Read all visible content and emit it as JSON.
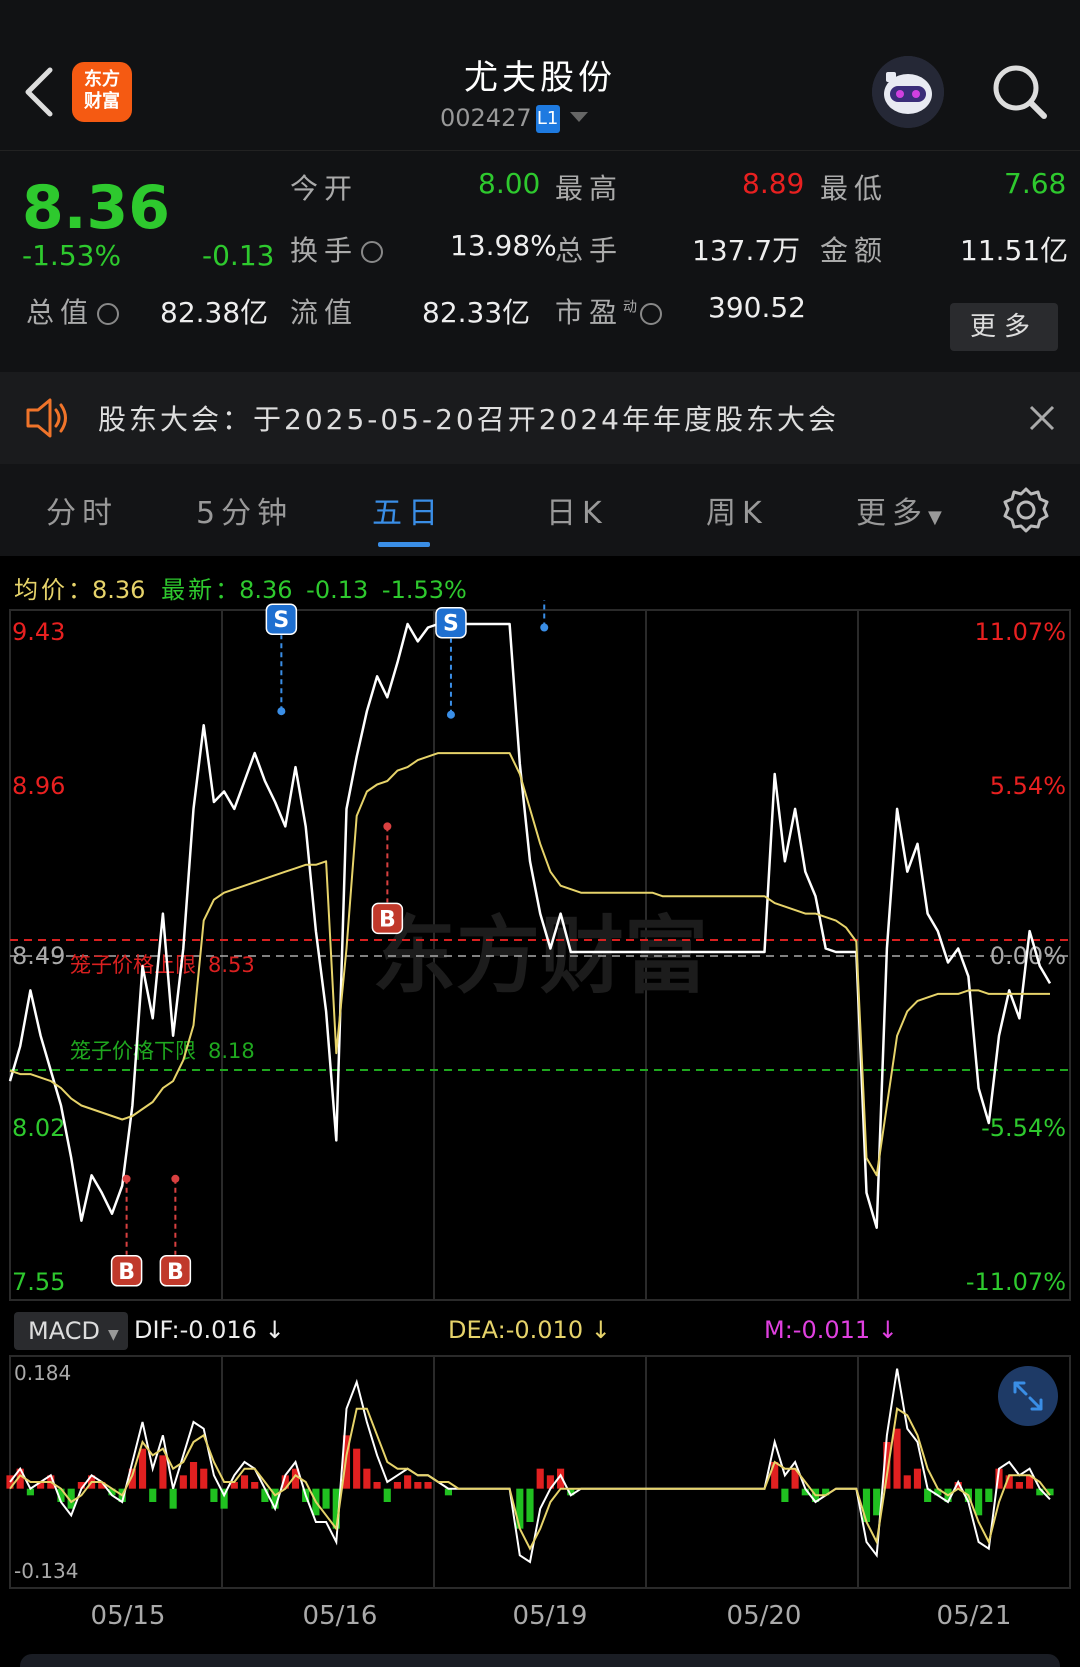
{
  "header": {
    "logo_line1": "东方",
    "logo_line2": "财富",
    "stock_name": "尤夫股份",
    "stock_code": "002427",
    "market_badge": "L1",
    "icons": [
      "back-arrow-icon",
      "robot-avatar-icon",
      "search-icon",
      "dropdown-triangle-icon"
    ]
  },
  "quote": {
    "price": "8.36",
    "change_pct": "-1.53%",
    "change": "-0.13",
    "open_label": "今开",
    "open": "8.00",
    "high_label": "最高",
    "high": "8.89",
    "low_label": "最低",
    "low": "7.68",
    "turnover_label": "换手",
    "turnover": "13.98%",
    "volume_label": "总手",
    "volume": "137.7万",
    "amount_label": "金额",
    "amount": "11.51亿",
    "mktcap_label": "总值",
    "mktcap": "82.38亿",
    "float_label": "流值",
    "float_cap": "82.33亿",
    "pe_label": "市盈",
    "pe_sup": "动",
    "pe": "390.52",
    "more_button": "更多",
    "colors": {
      "down": "#2ec92e",
      "up": "#e82020"
    }
  },
  "notice": {
    "text": "股东大会：于2025-05-20召开2024年年度股东大会",
    "icons": [
      "speaker-icon",
      "close-icon"
    ]
  },
  "tabs": {
    "items": [
      "分时",
      "5分钟",
      "五日",
      "日K",
      "周K",
      "更多"
    ],
    "active": "五日",
    "icons": [
      "settings-gear-icon"
    ]
  },
  "chart_data": {
    "type": "line",
    "legend": {
      "avg_label": "均价",
      "avg_value": "8.36",
      "latest_label": "最新",
      "latest_value": "8.36",
      "latest_change": "-0.13",
      "latest_pct": "-1.53%"
    },
    "left_ticks": [
      "9.43",
      "8.96",
      "8.49",
      "8.02",
      "7.55"
    ],
    "right_ticks": [
      "11.07%",
      "5.54%",
      "0.00%",
      "-5.54%",
      "-11.07%"
    ],
    "ylim": [
      7.55,
      9.43
    ],
    "prev_close": 8.49,
    "upper_band_label": "笼子价格上限",
    "upper_band_value": "8.53",
    "lower_band_label": "笼子价格下限",
    "lower_band_value": "8.18",
    "x_labels": [
      "05/15",
      "05/16",
      "05/19",
      "05/20",
      "05/21"
    ],
    "watermark": "东方财富",
    "markers": [
      {
        "label": "B",
        "day": 0,
        "pos": 0.55,
        "price": 7.84
      },
      {
        "label": "B",
        "day": 0,
        "pos": 0.78,
        "price": 7.84
      },
      {
        "label": "S",
        "day": 1,
        "pos": 0.28,
        "price": 9.18
      },
      {
        "label": "B",
        "day": 1,
        "pos": 0.78,
        "price": 8.85
      },
      {
        "label": "S",
        "day": 2,
        "pos": 0.08,
        "price": 9.17
      },
      {
        "label": "S",
        "day": 2,
        "pos": 0.52,
        "price": 9.42
      }
    ],
    "series": [
      {
        "name": "价格",
        "color": "#ffffff",
        "values": [
          8.12,
          8.22,
          8.38,
          8.25,
          8.15,
          8.05,
          7.9,
          7.72,
          7.85,
          7.8,
          7.74,
          7.82,
          8.05,
          8.45,
          8.3,
          8.6,
          8.25,
          8.5,
          8.9,
          9.14,
          8.92,
          8.95,
          8.9,
          8.98,
          9.06,
          8.98,
          8.92,
          8.85,
          9.02,
          8.85,
          8.55,
          8.32,
          7.95,
          8.9,
          9.05,
          9.18,
          9.28,
          9.22,
          9.32,
          9.43,
          9.38,
          9.42,
          9.43,
          9.4,
          9.43,
          9.43,
          9.43,
          9.43,
          9.43,
          9.43,
          9.03,
          8.75,
          8.6,
          8.5,
          8.6,
          8.49,
          8.49,
          8.49,
          8.49,
          8.49,
          8.49,
          8.49,
          8.49,
          8.49,
          8.49,
          8.49,
          8.49,
          8.49,
          8.49,
          8.49,
          8.49,
          8.49,
          8.49,
          8.49,
          8.49,
          9.0,
          8.75,
          8.9,
          8.72,
          8.65,
          8.5,
          8.49,
          8.49,
          8.49,
          7.8,
          7.7,
          8.5,
          8.9,
          8.72,
          8.8,
          8.6,
          8.55,
          8.46,
          8.5,
          8.42,
          8.1,
          8.0,
          8.25,
          8.38,
          8.3,
          8.55,
          8.45,
          8.4
        ]
      },
      {
        "name": "均价",
        "color": "#e6d36a",
        "values": [
          8.15,
          8.14,
          8.14,
          8.13,
          8.12,
          8.1,
          8.07,
          8.05,
          8.04,
          8.03,
          8.02,
          8.01,
          8.02,
          8.04,
          8.06,
          8.1,
          8.12,
          8.18,
          8.28,
          8.58,
          8.64,
          8.66,
          8.67,
          8.68,
          8.69,
          8.7,
          8.71,
          8.72,
          8.73,
          8.74,
          8.74,
          8.75,
          8.2,
          8.5,
          8.88,
          8.95,
          8.97,
          8.98,
          9.01,
          9.02,
          9.04,
          9.05,
          9.06,
          9.06,
          9.06,
          9.06,
          9.06,
          9.06,
          9.06,
          9.06,
          9.0,
          8.9,
          8.8,
          8.72,
          8.68,
          8.67,
          8.66,
          8.66,
          8.66,
          8.66,
          8.66,
          8.66,
          8.66,
          8.66,
          8.65,
          8.65,
          8.65,
          8.65,
          8.65,
          8.65,
          8.65,
          8.65,
          8.65,
          8.65,
          8.65,
          8.63,
          8.62,
          8.61,
          8.6,
          8.6,
          8.59,
          8.58,
          8.56,
          8.52,
          7.9,
          7.85,
          8.05,
          8.25,
          8.32,
          8.35,
          8.36,
          8.37,
          8.37,
          8.37,
          8.38,
          8.38,
          8.37,
          8.37,
          8.37,
          8.37,
          8.37,
          8.37,
          8.37
        ]
      }
    ],
    "macd": {
      "selector_label": "MACD",
      "dif_label": "DIF:-0.016 ↓",
      "dea_label": "DEA:-0.010 ↓",
      "m_label": "M:-0.011 ↓",
      "y_top": "0.184",
      "y_bottom": "-0.134",
      "ylim": [
        -0.134,
        0.184
      ],
      "dif_color": "#ffffff",
      "dea_color": "#e6d36a",
      "m_color": "#e040e0",
      "hist": [
        0.02,
        0.03,
        -0.01,
        0.01,
        0.02,
        -0.02,
        -0.03,
        0.01,
        0.02,
        0.01,
        -0.01,
        -0.02,
        0.03,
        0.06,
        -0.02,
        0.05,
        -0.03,
        0.02,
        0.04,
        0.03,
        -0.02,
        -0.03,
        0.01,
        0.02,
        0.01,
        -0.02,
        -0.03,
        0.02,
        0.03,
        -0.02,
        -0.04,
        -0.03,
        -0.06,
        0.08,
        0.06,
        0.03,
        0.01,
        -0.02,
        0.01,
        0.02,
        0.01,
        0.01,
        0.0,
        -0.01,
        0.0,
        0.0,
        0.0,
        0.0,
        0.0,
        0.0,
        -0.06,
        -0.05,
        0.03,
        0.02,
        0.03,
        -0.01,
        0.0,
        0.0,
        0.0,
        0.0,
        0.0,
        0.0,
        0.0,
        0.0,
        0.0,
        0.0,
        0.0,
        0.0,
        0.0,
        0.0,
        0.0,
        0.0,
        0.0,
        0.0,
        0.0,
        0.04,
        -0.02,
        0.03,
        -0.01,
        -0.02,
        -0.01,
        0.0,
        0.0,
        0.0,
        -0.05,
        -0.04,
        0.07,
        0.09,
        0.02,
        0.03,
        -0.02,
        -0.01,
        -0.02,
        0.01,
        -0.02,
        -0.04,
        -0.02,
        0.03,
        0.02,
        0.01,
        0.02,
        -0.01,
        -0.01
      ],
      "dif": [
        0.01,
        0.03,
        0.0,
        0.01,
        0.02,
        -0.02,
        -0.04,
        0.0,
        0.02,
        0.01,
        -0.01,
        -0.02,
        0.04,
        0.1,
        0.03,
        0.08,
        0.0,
        0.05,
        0.1,
        0.09,
        0.02,
        -0.01,
        0.02,
        0.04,
        0.03,
        0.0,
        -0.03,
        0.02,
        0.04,
        -0.01,
        -0.05,
        -0.05,
        -0.08,
        0.12,
        0.16,
        0.1,
        0.05,
        0.01,
        0.02,
        0.03,
        0.02,
        0.02,
        0.01,
        0.0,
        0.0,
        0.0,
        0.0,
        0.0,
        0.0,
        0.0,
        -0.1,
        -0.11,
        -0.03,
        0.0,
        0.02,
        -0.01,
        0.0,
        0.0,
        0.0,
        0.0,
        0.0,
        0.0,
        0.0,
        0.0,
        0.0,
        0.0,
        0.0,
        0.0,
        0.0,
        0.0,
        0.0,
        0.0,
        0.0,
        0.0,
        0.0,
        0.07,
        0.02,
        0.04,
        0.0,
        -0.02,
        -0.01,
        0.0,
        0.0,
        0.0,
        -0.08,
        -0.1,
        0.08,
        0.18,
        0.09,
        0.07,
        0.0,
        -0.01,
        -0.02,
        0.01,
        -0.02,
        -0.08,
        -0.09,
        0.03,
        0.04,
        0.02,
        0.03,
        0.0,
        -0.016
      ],
      "dea": [
        0.0,
        0.02,
        0.01,
        0.01,
        0.01,
        0.0,
        -0.02,
        -0.01,
        0.01,
        0.01,
        0.0,
        -0.01,
        0.02,
        0.07,
        0.05,
        0.06,
        0.03,
        0.04,
        0.07,
        0.08,
        0.04,
        0.01,
        0.01,
        0.03,
        0.03,
        0.01,
        -0.01,
        0.0,
        0.02,
        0.01,
        -0.02,
        -0.04,
        -0.06,
        0.05,
        0.12,
        0.12,
        0.08,
        0.04,
        0.03,
        0.03,
        0.02,
        0.02,
        0.01,
        0.01,
        0.0,
        0.0,
        0.0,
        0.0,
        0.0,
        0.0,
        -0.06,
        -0.09,
        -0.06,
        -0.02,
        0.0,
        0.0,
        0.0,
        0.0,
        0.0,
        0.0,
        0.0,
        0.0,
        0.0,
        0.0,
        0.0,
        0.0,
        0.0,
        0.0,
        0.0,
        0.0,
        0.0,
        0.0,
        0.0,
        0.0,
        0.0,
        0.04,
        0.03,
        0.03,
        0.01,
        -0.01,
        -0.01,
        0.0,
        0.0,
        0.0,
        -0.05,
        -0.08,
        0.02,
        0.12,
        0.11,
        0.08,
        0.03,
        0.0,
        -0.01,
        0.0,
        -0.01,
        -0.05,
        -0.08,
        -0.02,
        0.02,
        0.02,
        0.02,
        0.01,
        -0.01
      ]
    }
  }
}
